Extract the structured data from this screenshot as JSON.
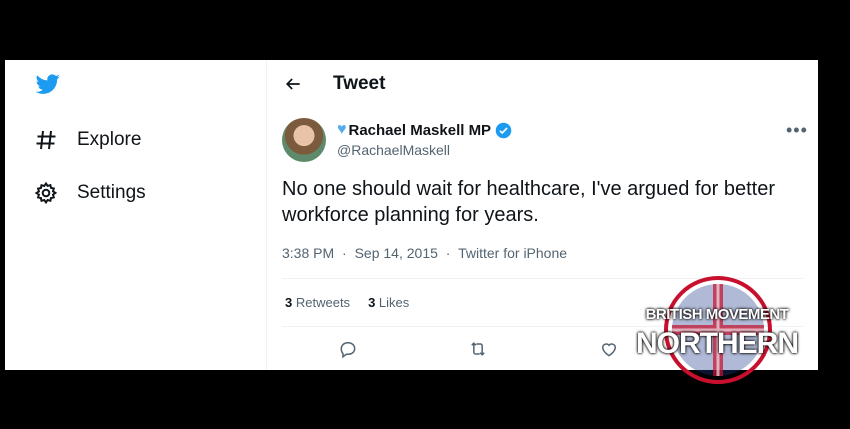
{
  "sidebar": {
    "items": [
      {
        "label": "Explore",
        "icon": "hashtag-icon"
      },
      {
        "label": "Settings",
        "icon": "gear-icon"
      }
    ]
  },
  "header": {
    "title": "Tweet"
  },
  "tweet": {
    "author_name": "Rachael Maskell MP",
    "handle": "@RachaelMaskell",
    "text": "No one should wait for healthcare, I've argued for better workforce planning for years.",
    "time": "3:38 PM",
    "date": "Sep 14, 2015",
    "source": "Twitter for iPhone",
    "retweets_count": "3",
    "retweets_label": "Retweets",
    "likes_count": "3",
    "likes_label": "Likes"
  },
  "watermark": {
    "line1": "BRITISH MOVEMENT",
    "line2": "NORTHERN"
  },
  "colors": {
    "brand_blue": "#1d9bf0",
    "text": "#0f1419",
    "muted": "#536471"
  }
}
